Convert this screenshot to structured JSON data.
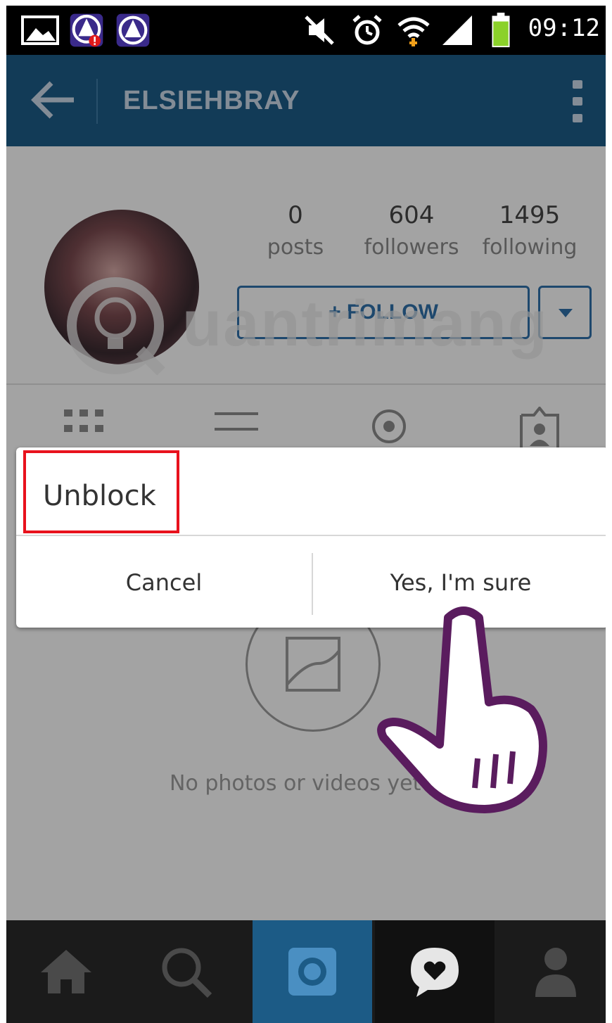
{
  "status_bar": {
    "time": "09:12",
    "icons": [
      "gallery-icon",
      "app-alert-icon",
      "app-icon",
      "mute-icon",
      "alarm-icon",
      "wifi-icon",
      "signal-icon",
      "battery-icon"
    ]
  },
  "header": {
    "username": "ELSIEHBRAY",
    "back_icon": "arrow-left-icon",
    "menu_icon": "more-vertical-icon"
  },
  "profile": {
    "stats": [
      {
        "value": "0",
        "label": "posts"
      },
      {
        "value": "604",
        "label": "followers"
      },
      {
        "value": "1495",
        "label": "following"
      }
    ],
    "follow_label": "+ FOLLOW",
    "tabs": [
      "grid-icon",
      "list-icon",
      "location-icon",
      "tagged-icon"
    ],
    "empty_text": "No photos or videos yet"
  },
  "watermark": {
    "text": "uantrimang"
  },
  "dialog": {
    "title": "Unblock",
    "cancel_label": "Cancel",
    "confirm_label": "Yes, I'm sure"
  },
  "bottom_nav": {
    "items": [
      "home-icon",
      "search-icon",
      "camera-icon",
      "activity-heart-icon",
      "profile-icon"
    ],
    "active_color": "#1c5b86"
  }
}
